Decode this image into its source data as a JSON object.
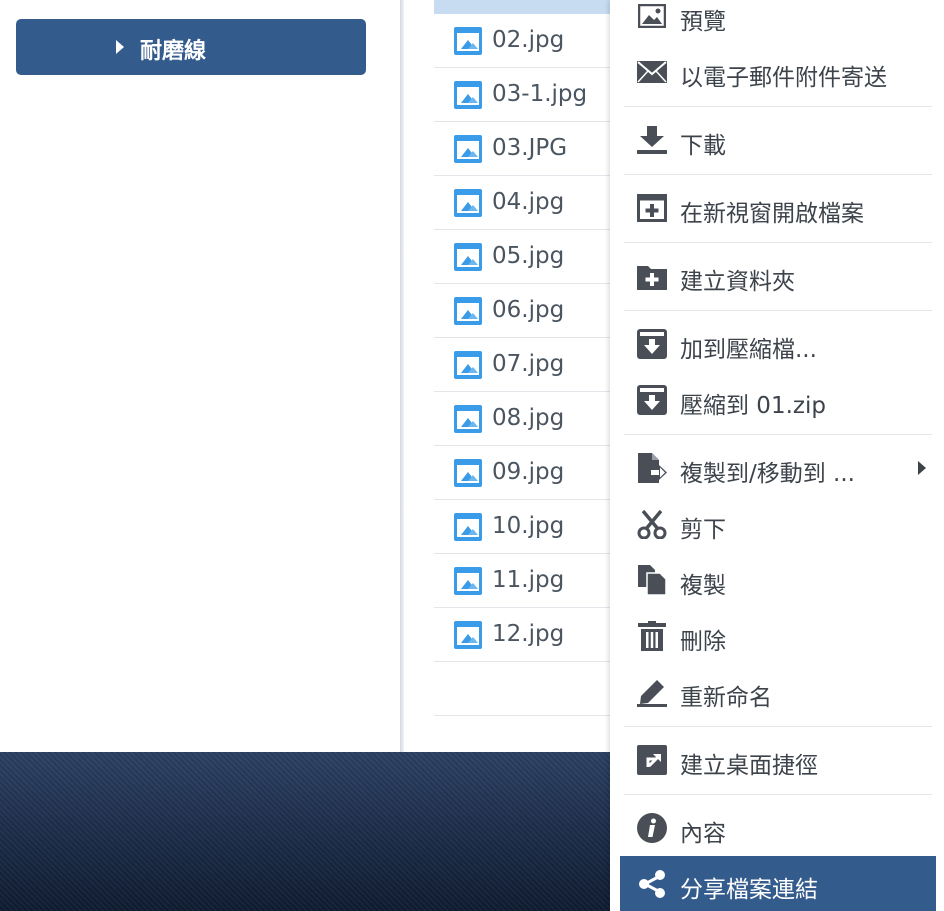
{
  "sidebar": {
    "nav_label": "耐磨線"
  },
  "files": [
    {
      "name": "02.jpg"
    },
    {
      "name": "03-1.jpg"
    },
    {
      "name": "03.JPG"
    },
    {
      "name": "04.jpg"
    },
    {
      "name": "05.jpg"
    },
    {
      "name": "06.jpg"
    },
    {
      "name": "07.jpg"
    },
    {
      "name": "08.jpg"
    },
    {
      "name": "09.jpg"
    },
    {
      "name": "10.jpg"
    },
    {
      "name": "11.jpg"
    },
    {
      "name": "12.jpg"
    }
  ],
  "context_menu": {
    "items": [
      {
        "label": "預覽",
        "icon": "image-icon"
      },
      {
        "label": "以電子郵件附件寄送",
        "icon": "envelope-icon"
      },
      {
        "label": "下載",
        "icon": "download-icon"
      },
      {
        "label": "在新視窗開啟檔案",
        "icon": "new-window-icon"
      },
      {
        "label": "建立資料夾",
        "icon": "folder-plus-icon"
      },
      {
        "label": "加到壓縮檔...",
        "icon": "archive-icon"
      },
      {
        "label": "壓縮到 01.zip",
        "icon": "archive-icon"
      },
      {
        "label": "複製到/移動到 ...",
        "icon": "copy-move-icon"
      },
      {
        "label": "剪下",
        "icon": "scissors-icon"
      },
      {
        "label": "複製",
        "icon": "copy-icon"
      },
      {
        "label": "刪除",
        "icon": "trash-icon"
      },
      {
        "label": "重新命名",
        "icon": "pencil-icon"
      },
      {
        "label": "建立桌面捷徑",
        "icon": "shortcut-icon"
      },
      {
        "label": "內容",
        "icon": "info-icon"
      },
      {
        "label": "分享檔案連結",
        "icon": "share-icon"
      }
    ]
  },
  "colors": {
    "accent": "#335b8c",
    "file_icon": "#3a9be8",
    "selected_row": "#c7dcf1"
  }
}
